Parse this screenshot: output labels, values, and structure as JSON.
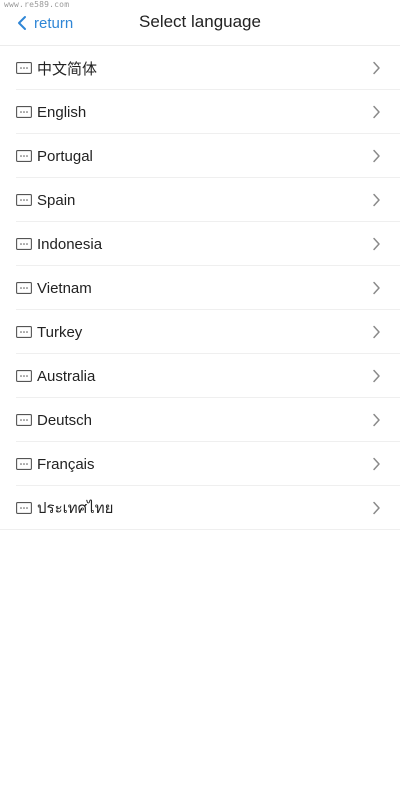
{
  "watermark": "www.re589.com",
  "header": {
    "back_label": "return",
    "title": "Select language"
  },
  "languages": [
    {
      "label": "中文简体"
    },
    {
      "label": "English"
    },
    {
      "label": "Portugal"
    },
    {
      "label": "Spain"
    },
    {
      "label": "Indonesia"
    },
    {
      "label": "Vietnam"
    },
    {
      "label": "Turkey"
    },
    {
      "label": "Australia"
    },
    {
      "label": "Deutsch"
    },
    {
      "label": "Français"
    },
    {
      "label": "ประเทศไทย"
    }
  ],
  "icons": {
    "back": "chevron-left-icon",
    "item": "keyboard-icon",
    "arrow": "chevron-right-icon"
  },
  "colors": {
    "accent": "#2f86d6",
    "text": "#222222",
    "divider": "#efefef"
  }
}
